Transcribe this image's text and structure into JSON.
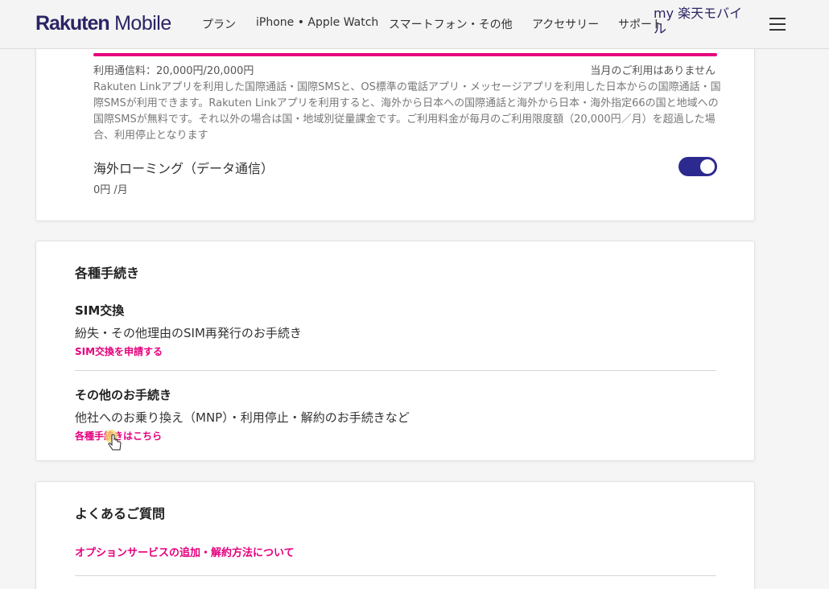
{
  "header": {
    "logo_brand": "Rakuten",
    "logo_product": "Mobile",
    "nav": [
      {
        "label": "プラン"
      },
      {
        "label": "iPhone • Apple Watch"
      },
      {
        "label": "スマートフォン・その他"
      },
      {
        "label": "アクセサリー"
      },
      {
        "label": "サポート"
      }
    ],
    "my_link": "my 楽天モバイル",
    "menu_icon": "hamburger-icon"
  },
  "intl_call": {
    "usage_label": "利用通信料：20,000円/20,000円",
    "usage_status": "当月のご利用はありません",
    "usage_fill": 1.0,
    "bar_color": "#e5007d",
    "description": "Rakuten Linkアプリを利用した国際通話・国際SMSと、OS標準の電話アプリ・メッセージアプリを利用した日本からの国際通話・国際SMSが利用できます。Rakuten Linkアプリを利用すると、海外から日本への国際通話と海外から日本・海外指定66の国と地域への国際SMSが無料です。それ以外の場合は国・地域別従量課金です。ご利用料金が毎月のご利用限度額（20,000円／月）を超過した場合、利用停止となります"
  },
  "roaming": {
    "title": "海外ローミング（データ通信）",
    "price": "0円 /月",
    "toggle_on": true,
    "toggle_color": "#2d2a8f"
  },
  "procedures": {
    "title": "各種手続き",
    "items": [
      {
        "title": "SIM交換",
        "description": "紛失・その他理由のSIM再発行のお手続き",
        "link": "SIM交換を申請する"
      },
      {
        "title": "その他のお手続き",
        "description": "他社へのお乗り換え（MNP）・利用停止・解約のお手続きなど",
        "link": "各種手続きはこちら"
      }
    ]
  },
  "faq": {
    "title": "よくあるご質問",
    "items": [
      {
        "link": "オプションサービスの追加・解約方法について"
      }
    ]
  },
  "accent_color": "#e5007d"
}
